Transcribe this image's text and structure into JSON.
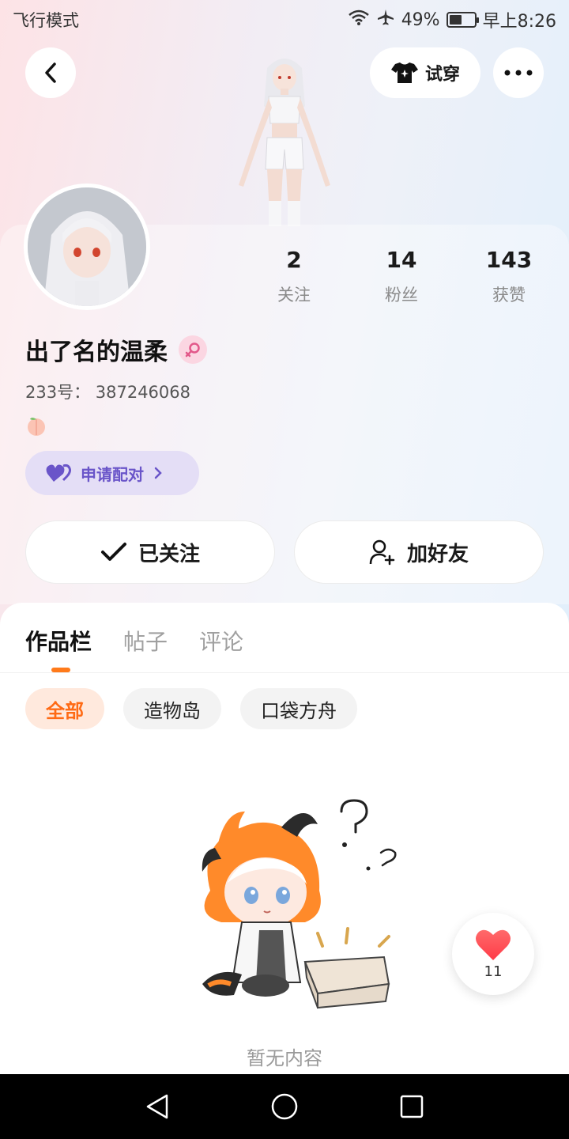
{
  "status_bar": {
    "mode": "飞行模式",
    "battery": "49%",
    "time": "早上8:26"
  },
  "header": {
    "try_on_label": "试穿"
  },
  "profile": {
    "username": "出了名的温柔",
    "uid": "233号： 387246068",
    "pair_label": "申请配对",
    "stats": [
      {
        "num": "2",
        "label": "关注"
      },
      {
        "num": "14",
        "label": "粉丝"
      },
      {
        "num": "143",
        "label": "获赞"
      }
    ],
    "follow_label": "已关注",
    "add_friend_label": "加好友"
  },
  "content": {
    "tabs": [
      "作品栏",
      "帖子",
      "评论"
    ],
    "chips": [
      "全部",
      "造物岛",
      "口袋方舟"
    ],
    "empty_text": "暂无内容"
  },
  "like_float": {
    "count": "11"
  },
  "colors": {
    "accent": "#ff7a1a",
    "pair_purple": "#6a55c9",
    "heart_red": "#ff4a55"
  }
}
